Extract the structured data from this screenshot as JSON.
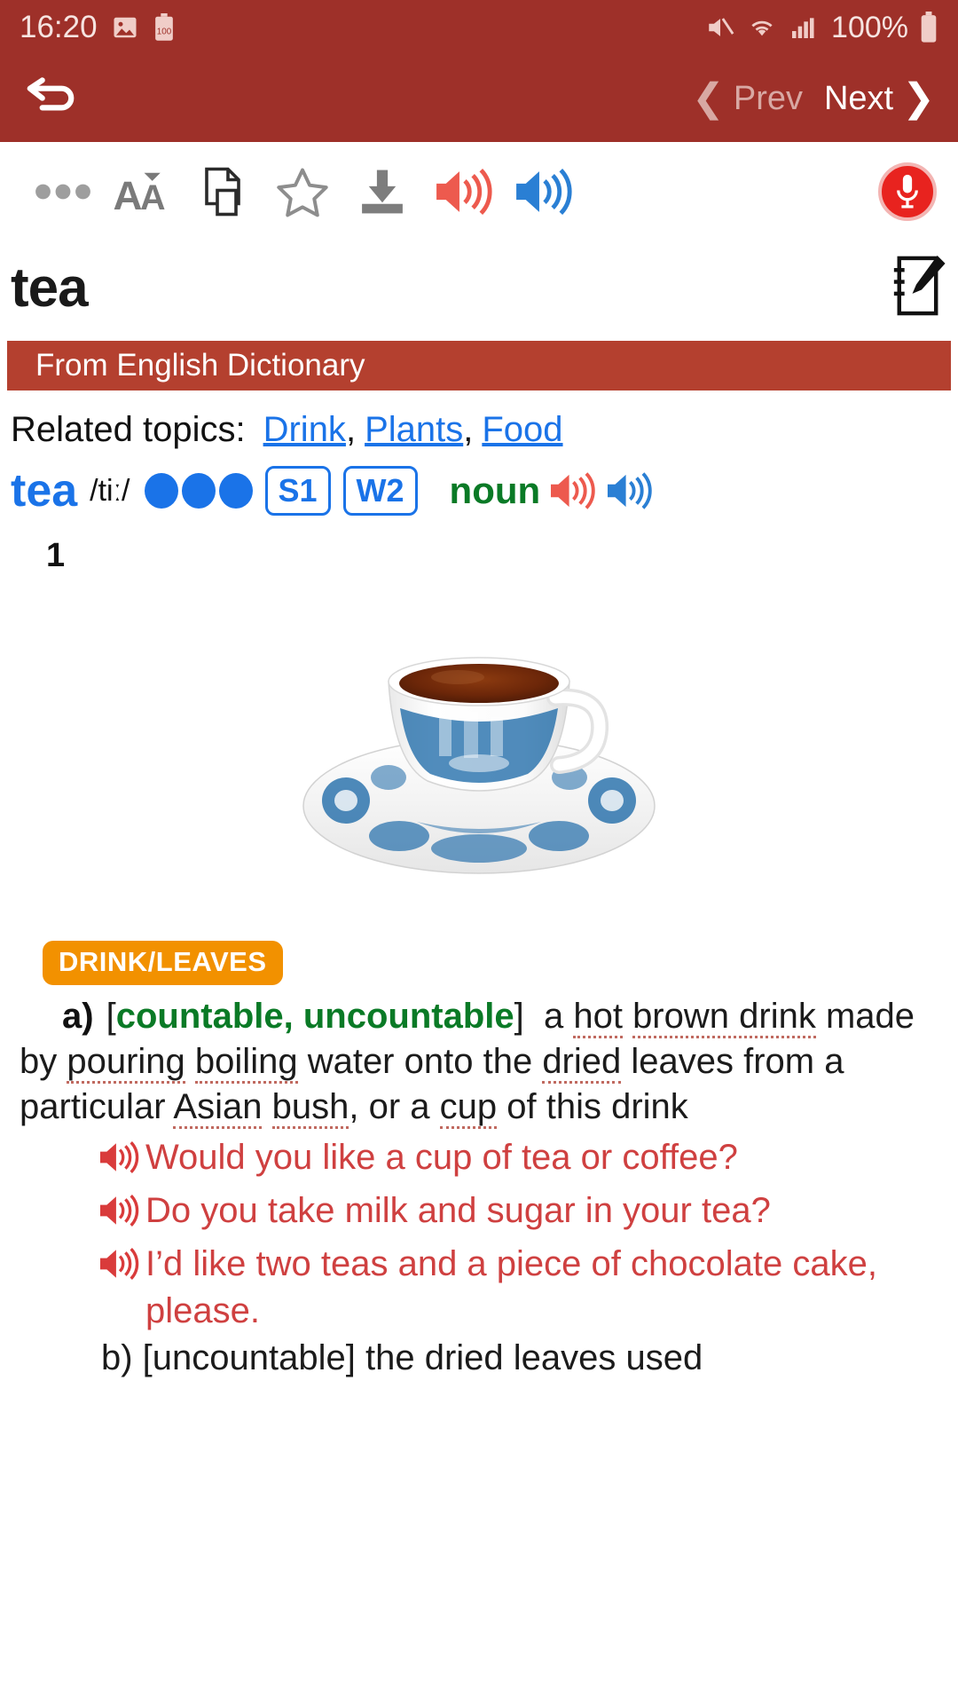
{
  "status_bar": {
    "clock": "16:20",
    "battery_percent": "100%",
    "icons": [
      "image-icon",
      "battery-saver-icon",
      "mute-icon",
      "wifi-icon",
      "signal-icon",
      "battery-icon"
    ],
    "battery_badge": "100"
  },
  "nav_bar": {
    "back_icon": "back-arrow-icon",
    "prev_label": "Prev",
    "next_label": "Next"
  },
  "toolbar": {
    "items": [
      {
        "name": "more-options-icon",
        "label": "•••"
      },
      {
        "name": "font-size-icon",
        "label": "AĀ"
      },
      {
        "name": "copy-icon",
        "label": "copy"
      },
      {
        "name": "favorite-star-icon",
        "label": "star"
      },
      {
        "name": "download-icon",
        "label": "download"
      },
      {
        "name": "speaker-red-icon",
        "label": "us-audio"
      },
      {
        "name": "speaker-blue-icon",
        "label": "uk-audio"
      }
    ],
    "mic_label": "microphone"
  },
  "entry": {
    "headword": "tea",
    "note_icon": "note-edit-icon",
    "source_banner": "From English Dictionary",
    "related_label": "Related topics:",
    "related_topics": [
      "Drink",
      "Plants",
      "Food"
    ],
    "pron_word": "tea",
    "ipa": "/tiː/",
    "frequency_dots": 3,
    "badges": [
      "S1",
      "W2"
    ],
    "part_of_speech": "noun",
    "sense_number": "1",
    "image_alt": "cup of tea on blue willow pattern saucer"
  },
  "sense": {
    "category_badge": "DRINK/LEAVES",
    "letter": "a)",
    "grammar_open": "[",
    "grammar": "countable, uncountable",
    "grammar_close": "]",
    "definition_parts": [
      {
        "text": "a ",
        "collocation": false
      },
      {
        "text": "hot",
        "collocation": true
      },
      {
        "text": " ",
        "collocation": false
      },
      {
        "text": "brown drink",
        "collocation": true
      },
      {
        "text": " made by ",
        "collocation": false
      },
      {
        "text": "pouring",
        "collocation": true
      },
      {
        "text": " ",
        "collocation": false
      },
      {
        "text": "boiling",
        "collocation": true
      },
      {
        "text": " water onto the ",
        "collocation": false
      },
      {
        "text": "dried",
        "collocation": true
      },
      {
        "text": " leaves from a particular ",
        "collocation": false
      },
      {
        "text": "Asian",
        "collocation": true
      },
      {
        "text": " ",
        "collocation": false
      },
      {
        "text": "bush",
        "collocation": true
      },
      {
        "text": ", or a ",
        "collocation": false
      },
      {
        "text": "cup",
        "collocation": true
      },
      {
        "text": " of this drink",
        "collocation": false
      }
    ],
    "examples": [
      "Would you like a cup of tea or coffee?",
      "Do you take milk and sugar in your tea?",
      "I’d like two teas and a piece of chocolate cake, please."
    ],
    "next_sense_partial": "b)   [uncountable]   the dried leaves used"
  },
  "colors": {
    "header_red": "#9e3029",
    "banner_red": "#b4402f",
    "link_blue": "#1a73e8",
    "pos_green": "#0a7a26",
    "badge_orange": "#f29100",
    "example_red": "#cf4040"
  }
}
